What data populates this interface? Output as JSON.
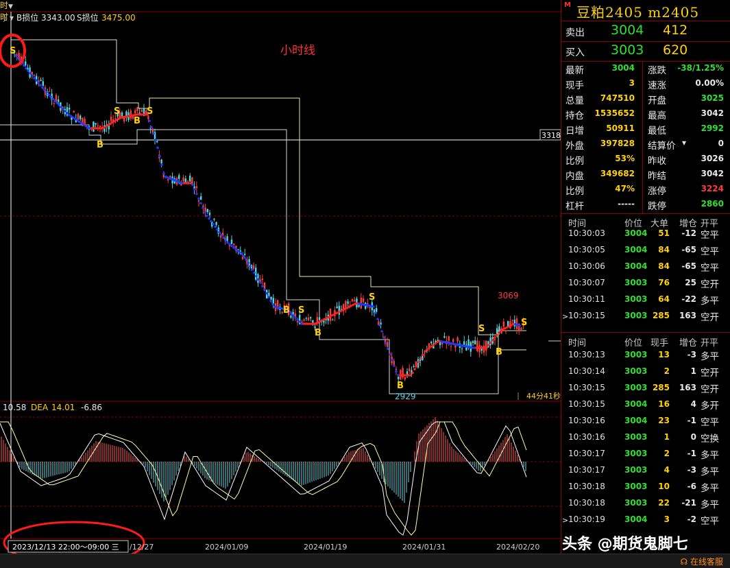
{
  "header": {
    "menu_glyph": "时",
    "b_stop_label": "B损位",
    "b_stop_value": "3343.00",
    "s_stop_label": "S损位",
    "s_stop_value": "3475.00"
  },
  "chart": {
    "annotation": "小时线",
    "right_price_label": "3318",
    "high_label": "3069",
    "low_label": "2929",
    "countdown": "44分41秒",
    "signal_s": "S",
    "signal_b": "B"
  },
  "macd": {
    "diff_value": "10.58",
    "dea_label": "DEA",
    "dea_value": "14.01",
    "macd_value": "-6.86"
  },
  "time_axis": {
    "cursor_time": "2023/12/13 22:00～09:00 三",
    "partial_label": "/12/27",
    "dates": [
      "2024/01/09",
      "2024/01/19",
      "2024/01/31",
      "2024/02/20"
    ]
  },
  "contract": {
    "marker": "M",
    "name": "豆粕2405",
    "code": "m2405"
  },
  "order_book": {
    "ask": {
      "label": "卖出",
      "price": "3004",
      "volume": "412"
    },
    "bid": {
      "label": "买入",
      "price": "3003",
      "volume": "620"
    }
  },
  "stats": {
    "left": [
      {
        "label": "最新",
        "value": "3004",
        "color": "g"
      },
      {
        "label": "现手",
        "value": "3",
        "color": "y"
      },
      {
        "label": "总量",
        "value": "747510",
        "color": "y"
      },
      {
        "label": "持仓",
        "value": "1535652",
        "color": "y"
      },
      {
        "label": "日增",
        "value": "50911",
        "color": "y"
      },
      {
        "label": "外盘",
        "value": "397828",
        "color": "y"
      },
      {
        "label": "比例",
        "value": "53%",
        "color": "y"
      },
      {
        "label": "内盘",
        "value": "349682",
        "color": "y"
      },
      {
        "label": "比例",
        "value": "47%",
        "color": "y"
      },
      {
        "label": "杠杆",
        "value": "-----",
        "color": "w"
      }
    ],
    "right": [
      {
        "label": "涨跌",
        "value": "-38/1.25%",
        "color": "g"
      },
      {
        "label": "速涨",
        "value": "0.00%",
        "color": "w"
      },
      {
        "label": "开盘",
        "value": "3025",
        "color": "g"
      },
      {
        "label": "最高",
        "value": "3042",
        "color": "w"
      },
      {
        "label": "最低",
        "value": "2992",
        "color": "g"
      },
      {
        "label": "结算价",
        "value": "0",
        "color": "w"
      },
      {
        "label": "昨收",
        "value": "3026",
        "color": "w"
      },
      {
        "label": "昨结",
        "value": "3042",
        "color": "w"
      },
      {
        "label": "涨停",
        "value": "3224",
        "color": "r"
      },
      {
        "label": "跌停",
        "value": "2860",
        "color": "g"
      }
    ]
  },
  "big_orders": {
    "headers": [
      "时间",
      "价位",
      "大单",
      "增仓",
      "开平"
    ],
    "rows": [
      {
        "time": "10:30:03",
        "price": "3004",
        "vol": "51",
        "chg": "-12",
        "type": "空平",
        "vc": "r"
      },
      {
        "time": "10:30:05",
        "price": "3004",
        "vol": "84",
        "chg": "-65",
        "type": "空平",
        "vc": "r"
      },
      {
        "time": "10:30:06",
        "price": "3004",
        "vol": "84",
        "chg": "-65",
        "type": "空平",
        "vc": "r"
      },
      {
        "time": "10:30:07",
        "price": "3003",
        "vol": "76",
        "chg": "25",
        "type": "空开",
        "vc": "g"
      },
      {
        "time": "10:30:11",
        "price": "3003",
        "vol": "64",
        "chg": "-22",
        "type": "多平",
        "vc": "g"
      },
      {
        "time": "10:30:15",
        "price": "3003",
        "vol": "285",
        "chg": "163",
        "type": "空开",
        "vc": "g"
      }
    ]
  },
  "ticks": {
    "headers": [
      "时间",
      "价位",
      "现手",
      "增仓",
      "开平"
    ],
    "rows": [
      {
        "time": "10:30:13",
        "price": "3003",
        "vol": "13",
        "chg": "-3",
        "type": "多平",
        "vc": "g"
      },
      {
        "time": "10:30:14",
        "price": "3003",
        "vol": "2",
        "chg": "1",
        "type": "空开",
        "vc": "g"
      },
      {
        "time": "10:30:15",
        "price": "3003",
        "vol": "285",
        "chg": "163",
        "type": "空开",
        "vc": "g"
      },
      {
        "time": "10:30:15",
        "price": "3004",
        "vol": "16",
        "chg": "4",
        "type": "多开",
        "vc": "r"
      },
      {
        "time": "10:30:16",
        "price": "3004",
        "vol": "23",
        "chg": "-1",
        "type": "空平",
        "vc": "r"
      },
      {
        "time": "10:30:16",
        "price": "3003",
        "vol": "1",
        "chg": "0",
        "type": "空换",
        "vc": "g"
      },
      {
        "time": "10:30:17",
        "price": "3003",
        "vol": "2",
        "chg": "-1",
        "type": "多平",
        "vc": "g"
      },
      {
        "time": "10:30:17",
        "price": "3003",
        "vol": "4",
        "chg": "-3",
        "type": "多平",
        "vc": "g"
      },
      {
        "time": "10:30:18",
        "price": "3003",
        "vol": "10",
        "chg": "-6",
        "type": "多平",
        "vc": "g"
      },
      {
        "time": "10:30:18",
        "price": "3003",
        "vol": "22",
        "chg": "-21",
        "type": "多平",
        "vc": "g"
      },
      {
        "time": "10:30:19",
        "price": "3004",
        "vol": "3",
        "chg": "-2",
        "type": "空平",
        "vc": "r"
      }
    ]
  },
  "watermark": "头条 @期货鬼脚七",
  "online_service": "在线客服",
  "colors": {
    "up": "#ff3c3c",
    "down": "#4fd8e0",
    "accent": "#ffd200",
    "frame": "#8b0000"
  }
}
